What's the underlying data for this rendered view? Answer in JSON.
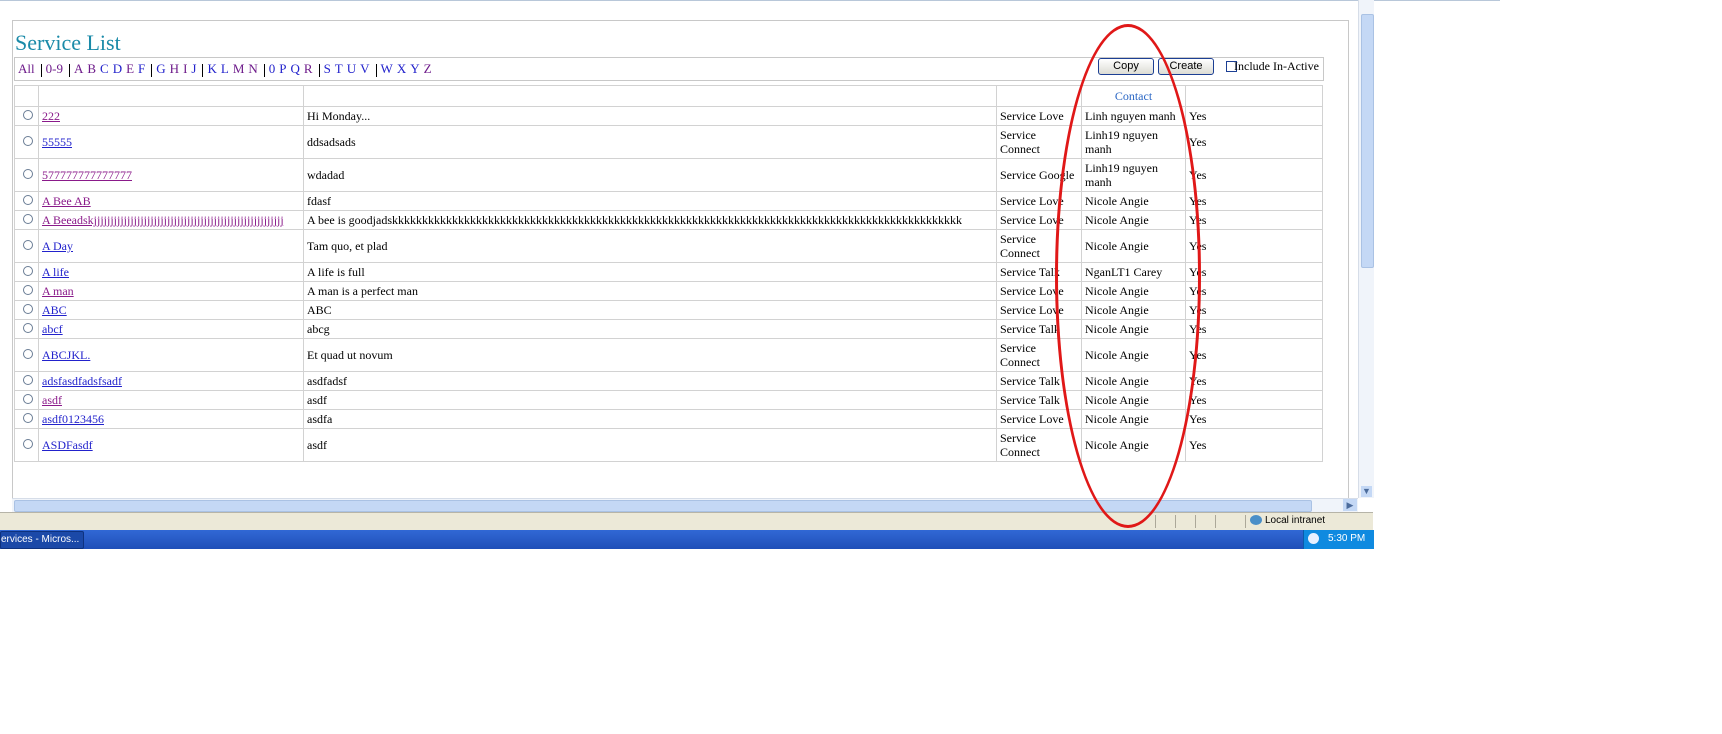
{
  "page": {
    "title": "Service List"
  },
  "alpha": {
    "groups": [
      [
        {
          "t": "All",
          "c": "visited"
        }
      ],
      [
        {
          "t": "0-9",
          "c": "visited"
        }
      ],
      [
        {
          "t": "A",
          "c": "visited"
        },
        {
          "t": "B",
          "c": "visited"
        },
        {
          "t": "C",
          "c": "blue"
        },
        {
          "t": "D",
          "c": "blue"
        },
        {
          "t": "E",
          "c": "visited"
        },
        {
          "t": "F",
          "c": "blue"
        }
      ],
      [
        {
          "t": "G",
          "c": "blue"
        },
        {
          "t": "H",
          "c": "visited"
        },
        {
          "t": "I",
          "c": "visited"
        },
        {
          "t": "J",
          "c": "blue"
        }
      ],
      [
        {
          "t": "K",
          "c": "blue"
        },
        {
          "t": "L",
          "c": "blue"
        },
        {
          "t": "M",
          "c": "visited"
        },
        {
          "t": "N",
          "c": "visited"
        }
      ],
      [
        {
          "t": "0",
          "c": "blue"
        },
        {
          "t": "P",
          "c": "blue"
        },
        {
          "t": "Q",
          "c": "blue"
        },
        {
          "t": "R",
          "c": "visited"
        }
      ],
      [
        {
          "t": "S",
          "c": "blue"
        },
        {
          "t": "T",
          "c": "blue"
        },
        {
          "t": "U",
          "c": "blue"
        },
        {
          "t": "V",
          "c": "blue"
        }
      ],
      [
        {
          "t": "W",
          "c": "blue"
        },
        {
          "t": "X",
          "c": "blue"
        },
        {
          "t": "Y",
          "c": "blue"
        },
        {
          "t": "Z",
          "c": "visited"
        }
      ]
    ]
  },
  "toolbar": {
    "copy_label": "Copy",
    "create_label": "Create",
    "include_inactive_label": "Include In-Active"
  },
  "table": {
    "header": [
      "",
      "",
      "",
      "",
      "Contact",
      ""
    ],
    "rows": [
      {
        "name": "222",
        "v": true,
        "desc": "Hi Monday...",
        "type": "Service Love",
        "contact": "Linh nguyen manh",
        "active": "Yes"
      },
      {
        "name": "55555",
        "v": false,
        "desc": "ddsadsads",
        "type": "Service Connect",
        "contact": "Linh19 nguyen manh",
        "active": "Yes"
      },
      {
        "name": "577777777777777",
        "v": true,
        "desc": "wdadad",
        "type": "Service Google",
        "contact": "Linh19 nguyen manh",
        "active": "Yes"
      },
      {
        "name": "A Bee AB",
        "v": true,
        "desc": "fdasf",
        "type": "Service Love",
        "contact": "Nicole Angie",
        "active": "Yes"
      },
      {
        "name": "A Beeadskjjjjjjjjjjjjjjjjjjjjjjjjjjjjjjjjjjjjjjjjjjjjjjjjjjjjjjjjj",
        "v": true,
        "desc": "A bee is goodjadskkkkkkkkkkkkkkkkkkkkkkkkkkkkkkkkkkkkkkkkkkkkkkkkkkkkkkkkkkkkkkkkkkkkkkkkkkkkkkkkkkkkkkkkkkkkkkk",
        "type": "Service Love",
        "contact": "Nicole Angie",
        "active": "Yes"
      },
      {
        "name": "A Day",
        "v": false,
        "desc": "Tam quo, et plad",
        "type": "Service Connect",
        "contact": "Nicole Angie",
        "active": "Yes"
      },
      {
        "name": "A life",
        "v": false,
        "desc": "A life is full",
        "type": "Service Talk",
        "contact": "NganLT1 Carey",
        "active": "Yes"
      },
      {
        "name": "A man",
        "v": true,
        "desc": "A man is a perfect man",
        "type": "Service Love",
        "contact": "Nicole Angie",
        "active": "Yes"
      },
      {
        "name": "ABC",
        "v": false,
        "desc": "ABC",
        "type": "Service Love",
        "contact": "Nicole Angie",
        "active": "Yes"
      },
      {
        "name": "abcf",
        "v": false,
        "desc": "abcg",
        "type": "Service Talk",
        "contact": "Nicole Angie",
        "active": "Yes"
      },
      {
        "name": "ABCJKL.",
        "v": false,
        "desc": "Et quad ut novum",
        "type": "Service Connect",
        "contact": "Nicole Angie",
        "active": "Yes"
      },
      {
        "name": "adsfasdfadsfsadf",
        "v": false,
        "desc": "asdfadsf",
        "type": "Service Talk",
        "contact": "Nicole Angie",
        "active": "Yes"
      },
      {
        "name": "asdf",
        "v": true,
        "desc": "asdf",
        "type": "Service Talk",
        "contact": "Nicole Angie",
        "active": "Yes"
      },
      {
        "name": "asdf0123456",
        "v": false,
        "desc": "asdfa",
        "type": "Service Love",
        "contact": "Nicole Angie",
        "active": "Yes"
      },
      {
        "name": "ASDFasdf",
        "v": false,
        "desc": "asdf",
        "type": "Service Connect",
        "contact": "Nicole Angie",
        "active": "Yes"
      }
    ]
  },
  "statusbar": {
    "zone": "Local intranet"
  },
  "taskbar": {
    "task": "ervices - Micros...",
    "clock": "5:30 PM"
  },
  "colors": {
    "title": "#1a8aa8",
    "link": "#2222cc",
    "visited": "#8a1a8a",
    "contact_header": "#2a66c4",
    "highlight_ellipse": "#e01818"
  }
}
